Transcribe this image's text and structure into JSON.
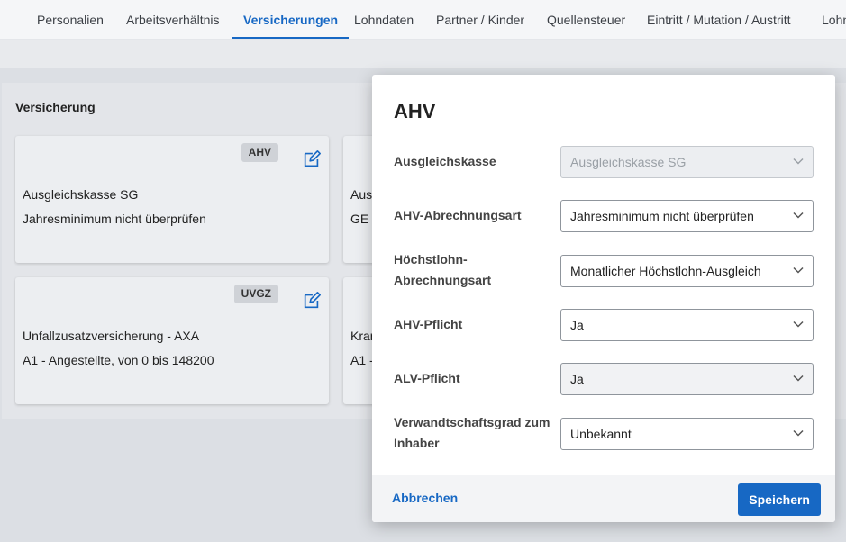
{
  "tabs": [
    {
      "label": "Personalien",
      "active": false
    },
    {
      "label": "Arbeitsverhältnis",
      "active": false
    },
    {
      "label": "Versicherungen",
      "active": true
    },
    {
      "label": "Lohndaten",
      "active": false
    },
    {
      "label": "Partner / Kinder",
      "active": false
    },
    {
      "label": "Quellensteuer",
      "active": false
    },
    {
      "label": "Eintritt / Mutation / Austritt",
      "active": false
    },
    {
      "label": "Lohn",
      "active": false
    }
  ],
  "panel": {
    "title": "Versicherung",
    "cards": [
      {
        "badge": "AHV",
        "line1": "Ausgleichskasse SG",
        "line2": "Jahresminimum nicht überprüfen"
      },
      {
        "badge": "",
        "line1": "Aus",
        "line2": "GE"
      },
      {
        "badge": "UVGZ",
        "line1": "Unfallzusatzversicherung - AXA",
        "line2": "A1 - Angestellte, von 0 bis 148200"
      },
      {
        "badge": "",
        "line1": "Kran",
        "line2": "A1 -"
      }
    ]
  },
  "modal": {
    "title": "AHV",
    "fields": [
      {
        "label": "Ausgleichskasse",
        "value": "Ausgleichskasse SG",
        "disabled": true
      },
      {
        "label": "AHV-Abrechnungsart",
        "value": "Jahresminimum nicht überprüfen",
        "disabled": false
      },
      {
        "label_line1": "Höchstlohn-",
        "label_line2": "Abrechnungsart",
        "value": "Monatlicher Höchstlohn-Ausgleich",
        "disabled": false
      },
      {
        "label": "AHV-Pflicht",
        "value": "Ja",
        "disabled": false
      },
      {
        "label": "ALV-Pflicht",
        "value": "Ja",
        "disabled": false
      },
      {
        "label_line1": "Verwandtschaftsgrad zum",
        "label_line2": "Inhaber",
        "value": "Unbekannt",
        "disabled": false
      }
    ],
    "cancel_label": "Abbrechen",
    "save_label": "Speichern"
  },
  "colors": {
    "accent": "#1768c4",
    "background": "#dcdfe4",
    "card": "#eceef1"
  }
}
